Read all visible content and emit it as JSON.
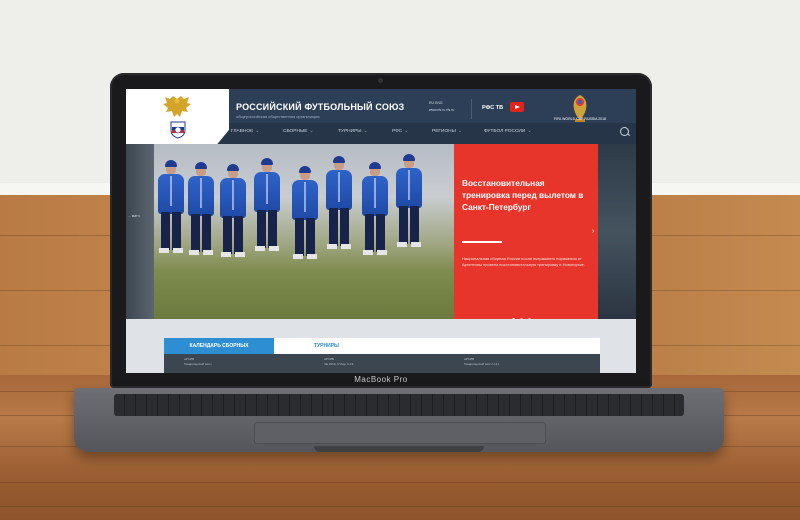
{
  "site": {
    "title": "РОССИЙСКИЙ ФУТБОЛЬНЫЙ СОЮЗ",
    "subtitle": "общероссийская общественная организация",
    "lang_lines": [
      "RU    ENG",
      "www.rfs.ru    rfs.ru"
    ],
    "tv_label": "РФС ТВ",
    "wc_text": "FIFA WORLD CUP RUSSIA 2018"
  },
  "nav": {
    "items": [
      "ГЛАВНОЕ",
      "СБОРНЫЕ",
      "ТУРНИРЫ",
      "РФС",
      "РЕГИОНЫ",
      "ФУТБОЛ РОССИИ"
    ]
  },
  "hero": {
    "left_label": "... матч",
    "headline": "Восстановительная тренировка перед вылетом в Санкт-Петербург",
    "description": "Национальная сборная России после вчерашнего поражения от Аргентины провела восстановительную тренировку в Новогорске.",
    "slides": 3,
    "active_slide": 1
  },
  "tabs": {
    "active": "КАЛЕНДАРЬ СБОРНЫХ",
    "second": "ТУРНИРЫ"
  },
  "calendar": [
    {
      "label": "АРХИВ",
      "value": "Товарищеский матч"
    },
    {
      "label": "АРХИВ",
      "value": "ЧЕ 2019, Отбор U-19"
    },
    {
      "label": "АРХИВ",
      "value": "Товарищеский матч U-21"
    }
  ],
  "laptop": {
    "brand": "MacBook Pro"
  },
  "colors": {
    "header": "#2d3f57",
    "accent_red": "#e8352c",
    "tab_blue": "#2d8fd1"
  },
  "icons": [
    "eagle-crest-icon",
    "youtube-icon",
    "world-cup-logo-icon",
    "search-icon"
  ]
}
